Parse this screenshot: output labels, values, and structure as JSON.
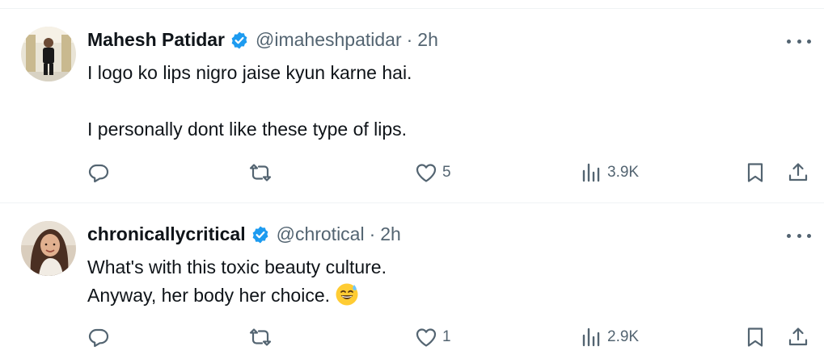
{
  "tweets": [
    {
      "name": "Mahesh Patidar",
      "handle": "@imaheshpatidar",
      "separator": "·",
      "time": "2h",
      "lines": [
        "I logo ko lips nigro jaise kyun karne hai.",
        "",
        "I personally dont like these type of lips."
      ],
      "reply_count": "",
      "repost_count": "",
      "like_count": "5",
      "view_count": "3.9K"
    },
    {
      "name": "chronicallycritical",
      "handle": "@chrotical",
      "separator": "·",
      "time": "2h",
      "lines": [
        "What's with this toxic beauty culture.",
        "Anyway, her body her choice."
      ],
      "emoji": "sweat-smile-emoji",
      "reply_count": "",
      "repost_count": "",
      "like_count": "1",
      "view_count": "2.9K"
    }
  ],
  "colors": {
    "text": "#0f1419",
    "muted": "#536471",
    "verified": "#1d9bf0",
    "divider": "#eff3f4"
  },
  "icons": [
    "verified-badge-icon",
    "more-icon",
    "reply-icon",
    "repost-icon",
    "like-icon",
    "views-icon",
    "bookmark-icon",
    "share-icon"
  ]
}
